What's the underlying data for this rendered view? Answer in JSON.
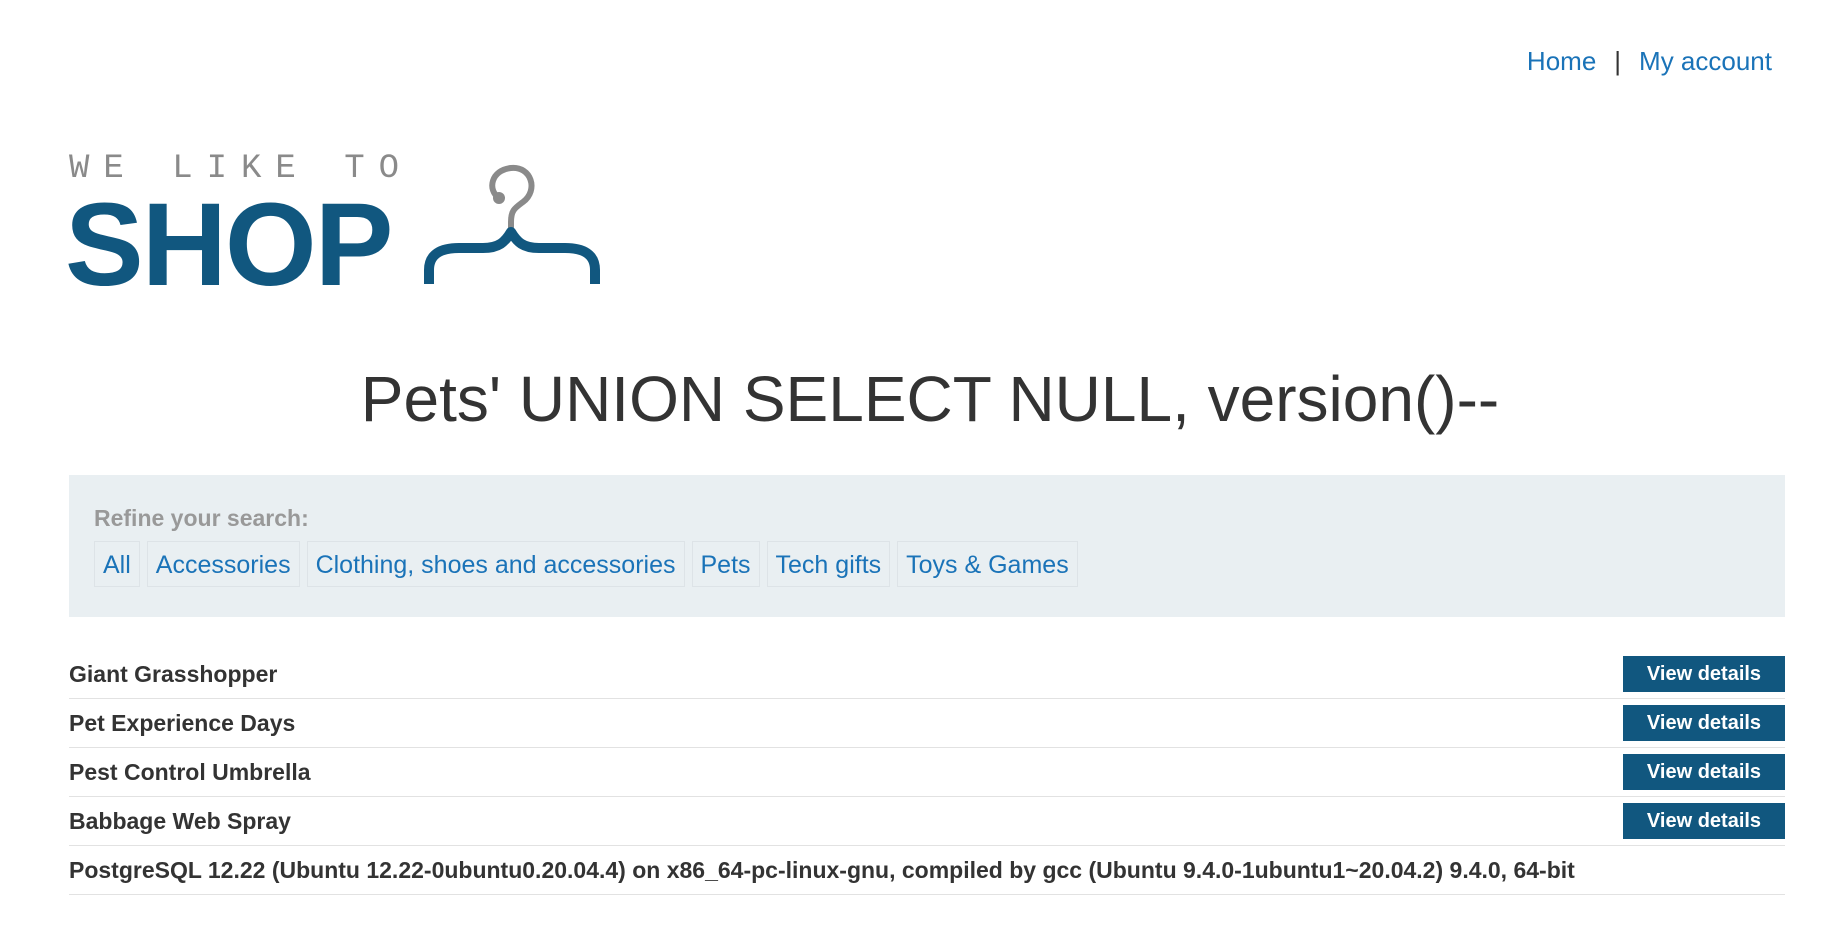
{
  "nav": {
    "home_label": "Home",
    "separator": "|",
    "account_label": "My account"
  },
  "logo": {
    "tagline": "WE LIKE TO",
    "word": "SHOP",
    "icon": "hanger-icon",
    "brand_color": "#11577f"
  },
  "page": {
    "title": "Pets' UNION SELECT NULL, version()--"
  },
  "filter": {
    "label": "Refine your search:",
    "categories": [
      "All",
      "Accessories",
      "Clothing, shoes and accessories",
      "Pets",
      "Tech gifts",
      "Toys & Games"
    ]
  },
  "products": [
    {
      "name": "Giant Grasshopper",
      "button": "View details"
    },
    {
      "name": "Pet Experience Days",
      "button": "View details"
    },
    {
      "name": "Pest Control Umbrella",
      "button": "View details"
    },
    {
      "name": "Babbage Web Spray",
      "button": "View details"
    },
    {
      "name": "PostgreSQL 12.22 (Ubuntu 12.22-0ubuntu0.20.04.4) on x86_64-pc-linux-gnu, compiled by gcc (Ubuntu 9.4.0-1ubuntu1~20.04.2) 9.4.0, 64-bit",
      "button": null
    }
  ],
  "colors": {
    "link": "#1a73b8",
    "button_bg": "#11577f",
    "panel_bg": "#e9eff2"
  }
}
